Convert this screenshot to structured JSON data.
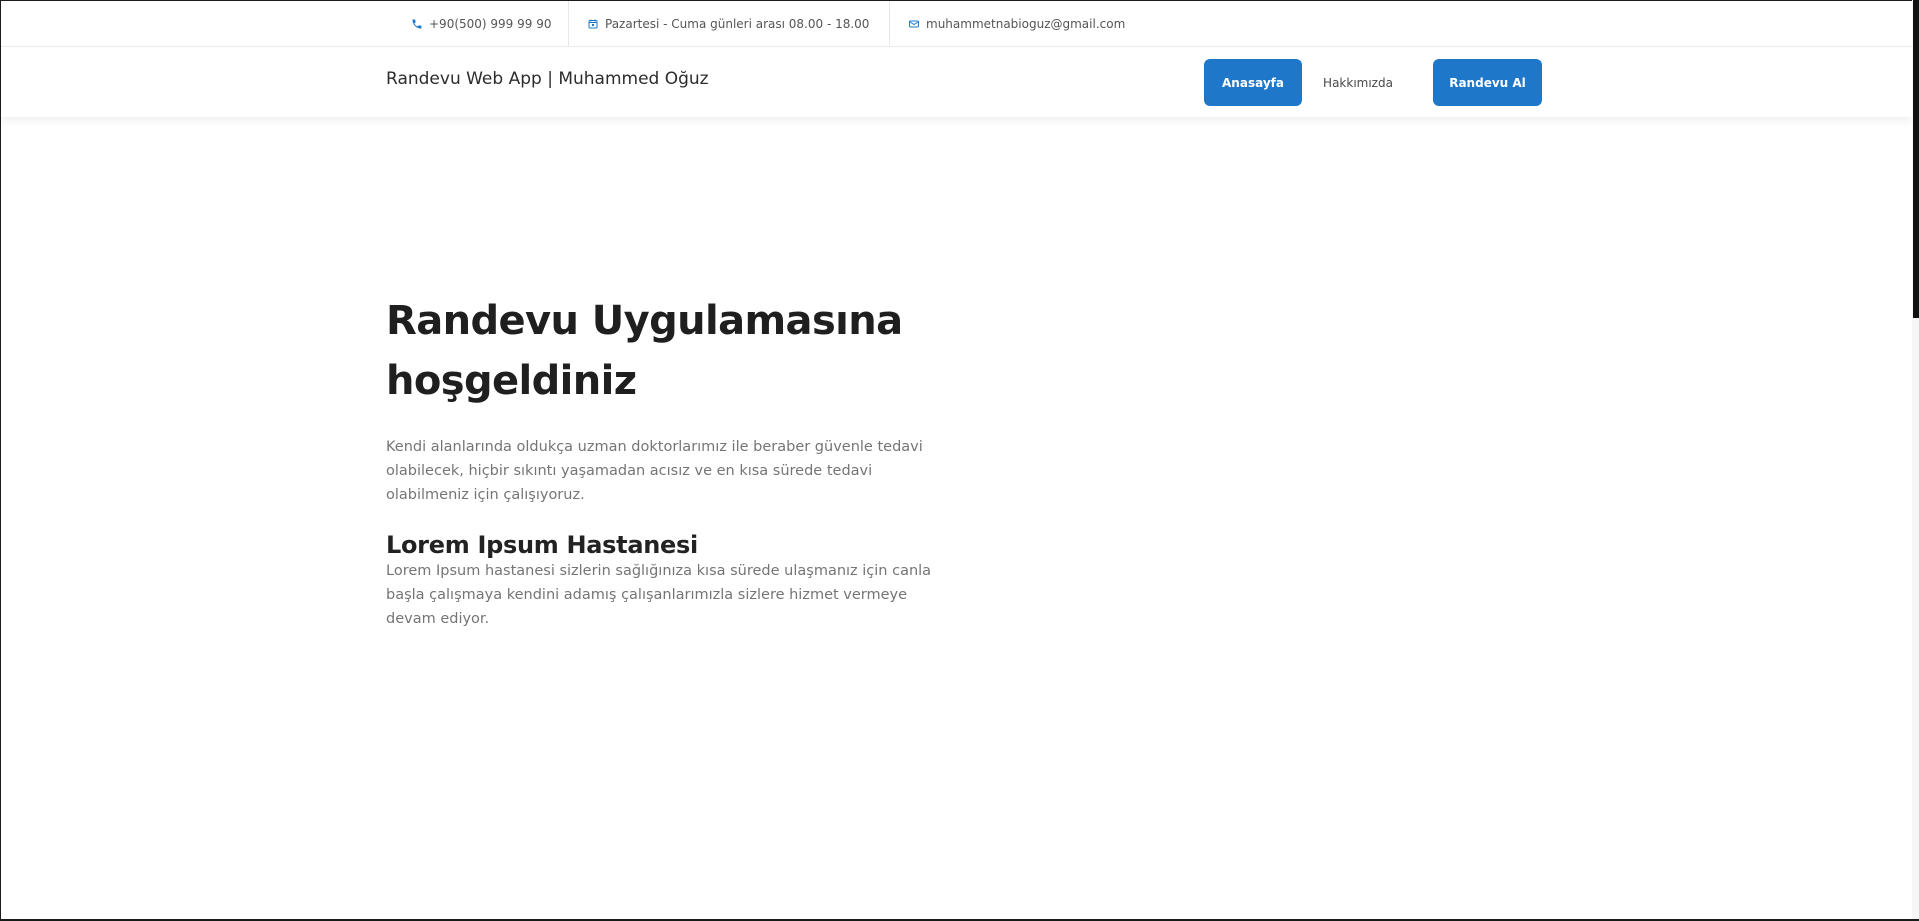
{
  "topbar": {
    "phone": "+90(500) 999 99 90",
    "schedule": "Pazartesi - Cuma günleri arası 08.00 - 18.00",
    "email": "muhammetnabioguz@gmail.com"
  },
  "nav": {
    "brand": "Randevu Web App | Muhammed Oğuz",
    "items": [
      {
        "label": "Anasayfa"
      },
      {
        "label": "Hakkımızda"
      },
      {
        "label": "Randevu Al"
      }
    ]
  },
  "hero": {
    "title": "Randevu Uygulamasına hoşgeldiniz",
    "text": "Kendi alanlarında oldukça uzman doktorlarımız ile beraber güvenle tedavi olabilecek, hiçbir sıkıntı yaşamadan acısız ve en kısa sürede tedavi olabilmeniz için çalışıyoruz."
  },
  "section": {
    "title": "Lorem Ipsum Hastanesi",
    "text": "Lorem Ipsum hastanesi sizlerin sağlığınıza kısa sürede ulaşmanız için canla başla çalışmaya kendini adamış çalışanlarımızla sizlere hizmet vermeye devam ediyor."
  },
  "colors": {
    "primary": "#1f77c9",
    "text": "#222222",
    "muted": "#757575"
  },
  "icons": {
    "phone": "phone-icon",
    "schedule": "calendar-icon",
    "email": "mail-icon"
  }
}
